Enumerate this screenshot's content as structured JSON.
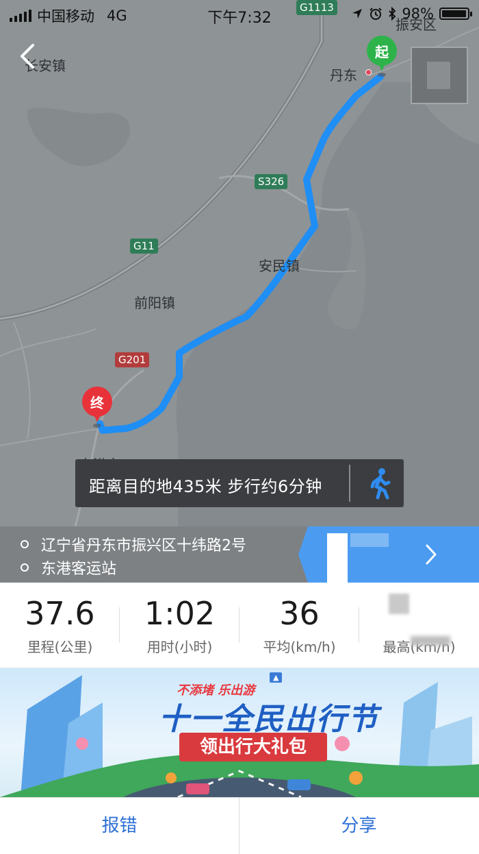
{
  "status_bar": {
    "carrier": "中国移动",
    "network": "4G",
    "time": "下午7:32",
    "battery_percent": "98%",
    "battery_level": 0.98
  },
  "map": {
    "labels": {
      "zhenan": "振安区",
      "dandong": "丹东",
      "changan": "长安镇",
      "anmin": "安民镇",
      "qianyang": "前阳镇",
      "donggang": "东港市"
    },
    "roads": {
      "g1113": "G1113",
      "s326": "S326",
      "g11": "G11",
      "g201": "G201"
    },
    "start_marker": "起",
    "end_marker": "终",
    "colors": {
      "route": "#1f8ef5",
      "start": "#2db34a",
      "end": "#e8323a"
    }
  },
  "info_banner": {
    "text": "距离目的地435米 步行约6分钟",
    "icon": "walk-icon"
  },
  "addresses": {
    "origin": "辽宁省丹东市振兴区十纬路2号",
    "destination": "东港客运站"
  },
  "stats": [
    {
      "value": "37.6",
      "label": "里程(公里)"
    },
    {
      "value": "1:02",
      "label": "用时(小时)"
    },
    {
      "value": "36",
      "label": "平均(km/h)"
    },
    {
      "value": "",
      "label": "最高(km/h)"
    }
  ],
  "ad": {
    "headline": "不添堵 乐出游",
    "title": "十一全民出行节",
    "ribbon": "领出行大礼包"
  },
  "bottom_bar": {
    "report": "报错",
    "share": "分享"
  }
}
